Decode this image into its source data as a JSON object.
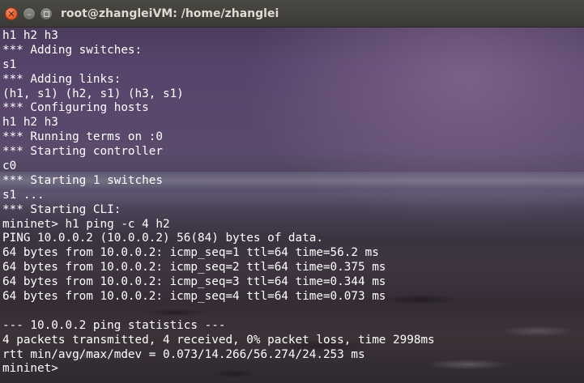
{
  "window": {
    "title": "root@zhangleiVM: /home/zhanglei",
    "close_glyph": "✕",
    "min_glyph": "–"
  },
  "terminal": {
    "lines": [
      "h1 h2 h3",
      "*** Adding switches:",
      "s1",
      "*** Adding links:",
      "(h1, s1) (h2, s1) (h3, s1)",
      "*** Configuring hosts",
      "h1 h2 h3",
      "*** Running terms on :0",
      "*** Starting controller",
      "c0",
      "*** Starting 1 switches",
      "s1 ...",
      "*** Starting CLI:",
      "mininet> h1 ping -c 4 h2",
      "PING 10.0.0.2 (10.0.0.2) 56(84) bytes of data.",
      "64 bytes from 10.0.0.2: icmp_seq=1 ttl=64 time=56.2 ms",
      "64 bytes from 10.0.0.2: icmp_seq=2 ttl=64 time=0.375 ms",
      "64 bytes from 10.0.0.2: icmp_seq=3 ttl=64 time=0.344 ms",
      "64 bytes from 10.0.0.2: icmp_seq=4 ttl=64 time=0.073 ms",
      "",
      "--- 10.0.0.2 ping statistics ---",
      "4 packets transmitted, 4 received, 0% packet loss, time 2998ms",
      "rtt min/avg/max/mdev = 0.073/14.266/56.274/24.253 ms",
      "mininet> "
    ]
  },
  "colors": {
    "text": "#ffffff",
    "close_button": "#e2531f",
    "titlebar": "#3b3a36"
  }
}
